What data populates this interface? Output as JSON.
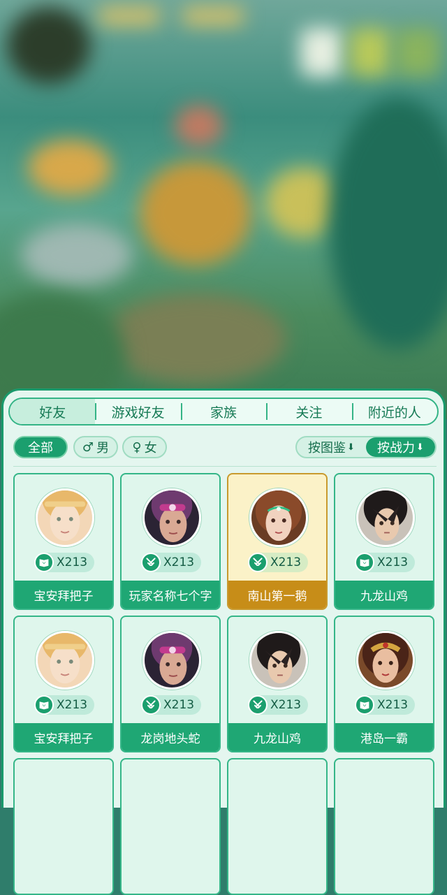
{
  "tabs": [
    {
      "label": "好友",
      "active": true
    },
    {
      "label": "游戏好友",
      "active": false
    },
    {
      "label": "家族",
      "active": false
    },
    {
      "label": "关注",
      "active": false
    },
    {
      "label": "附近的人",
      "active": false
    }
  ],
  "filters": {
    "all": "全部",
    "male": "男",
    "female": "女",
    "male_symbol": "♂",
    "female_symbol": "♀"
  },
  "sort": {
    "by_collection": "按图鉴",
    "by_power": "按战力",
    "active": "by_power"
  },
  "friends": [
    {
      "name": "宝安拜把子",
      "count": "X213",
      "badge_icon": "book-fox-icon",
      "avatar": "blonde-girl",
      "selected": false
    },
    {
      "name": "玩家名称七个字",
      "count": "X213",
      "badge_icon": "crossed-swords-icon",
      "avatar": "purple-hair-girl",
      "selected": false
    },
    {
      "name": "南山第一鹅",
      "count": "X213",
      "badge_icon": "crossed-swords-icon",
      "avatar": "brown-hair-woman",
      "selected": true
    },
    {
      "name": "九龙山鸡",
      "count": "X213",
      "badge_icon": "book-fox-icon",
      "avatar": "dark-hair-boy",
      "selected": false
    },
    {
      "name": "宝安拜把子",
      "count": "X213",
      "badge_icon": "book-fox-icon",
      "avatar": "blonde-girl",
      "selected": false
    },
    {
      "name": "龙岗地头蛇",
      "count": "X213",
      "badge_icon": "crossed-swords-icon",
      "avatar": "purple-hair-girl",
      "selected": false
    },
    {
      "name": "九龙山鸡",
      "count": "X213",
      "badge_icon": "crossed-swords-icon",
      "avatar": "dark-hair-boy",
      "selected": false
    },
    {
      "name": "港岛一霸",
      "count": "X213",
      "badge_icon": "book-fox-icon",
      "avatar": "warrior-woman",
      "selected": false
    }
  ],
  "colors": {
    "accent": "#1fa774",
    "selected": "#c78d18",
    "panel_bg": "#e4f6ef"
  }
}
